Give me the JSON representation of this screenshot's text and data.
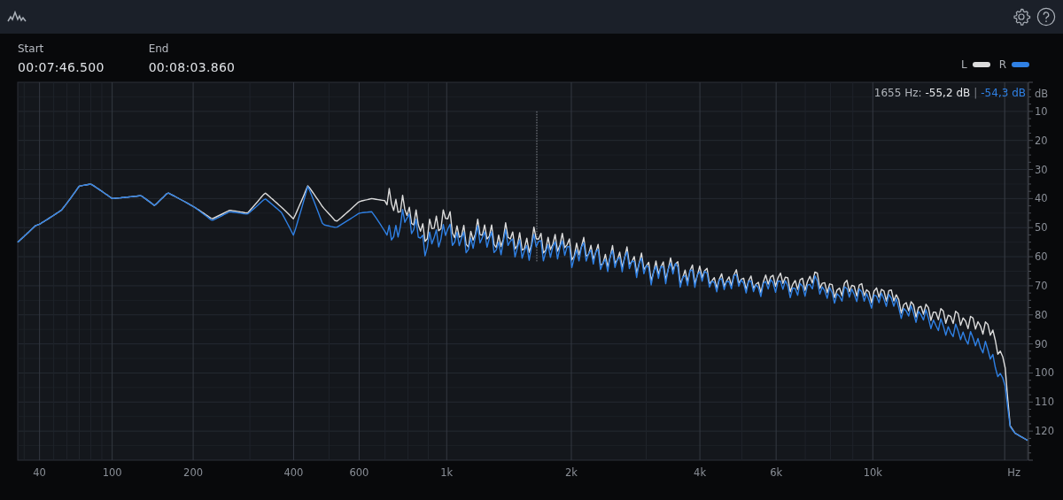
{
  "selection": {
    "start": {
      "label": "Start",
      "value": "00:07:46.500"
    },
    "end": {
      "label": "End",
      "value": "00:08:03.860"
    }
  },
  "legend": [
    {
      "label": "L",
      "color": "#dcdcdc"
    },
    {
      "label": "R",
      "color": "#2f80e4"
    }
  ],
  "readout": {
    "frequency": "1655 Hz:",
    "left": "-55,2 dB",
    "separator": "|",
    "right": "-54,3 dB"
  },
  "spectrum": {
    "kind": "picture",
    "y_unit": "dB",
    "y_labels": [
      "10",
      "20",
      "30",
      "40",
      "50",
      "60",
      "70",
      "80",
      "90",
      "100",
      "110",
      "120"
    ],
    "x_labels": [
      "40",
      "100",
      "200",
      "400",
      "600",
      "1k",
      "2k",
      "4k",
      "6k",
      "10k"
    ],
    "x_unit": "Hz"
  }
}
